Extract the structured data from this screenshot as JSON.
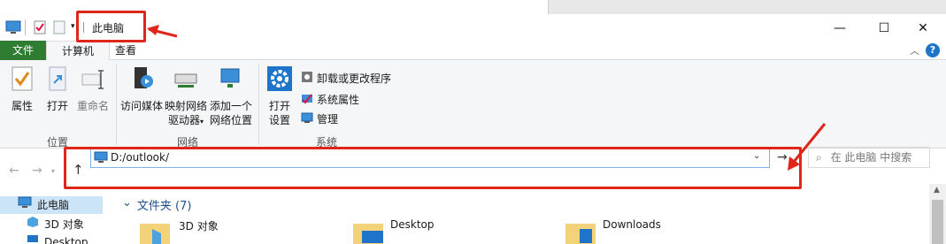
{
  "window": {
    "title": "此电脑",
    "controls": {
      "minimize": "—",
      "maximize": "☐",
      "close": "✕"
    }
  },
  "tabs": {
    "file": "文件",
    "computer": "计算机",
    "view": "查看"
  },
  "ribbon": {
    "location": {
      "label": "位置",
      "properties": "属性",
      "open": "打开",
      "rename": "重命名"
    },
    "network": {
      "label": "网络",
      "access_media": "访问媒体",
      "map_drive_1": "映射网络",
      "map_drive_2": "驱动器",
      "add_location_1": "添加一个",
      "add_location_2": "网络位置"
    },
    "system": {
      "label": "系统",
      "open_settings_1": "打开",
      "open_settings_2": "设置",
      "uninstall": "卸载或更改程序",
      "system_properties": "系统属性",
      "manage": "管理"
    }
  },
  "address": {
    "value": "D:/outlook/"
  },
  "search": {
    "placeholder": "在 此电脑 中搜索"
  },
  "sidebar": {
    "items": [
      {
        "label": "此电脑"
      },
      {
        "label": "3D 对象"
      },
      {
        "label": "Desktop"
      }
    ]
  },
  "content": {
    "section_title": "文件夹 (7)",
    "folders": [
      {
        "label": "3D 对象"
      },
      {
        "label": "Desktop"
      },
      {
        "label": "Downloads"
      }
    ]
  },
  "colors": {
    "annotation": "#e0261b",
    "accent": "#1e74c8",
    "file_tab": "#2e7d32"
  }
}
